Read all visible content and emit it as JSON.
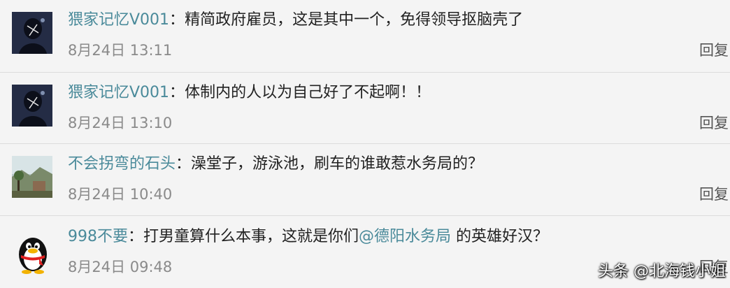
{
  "comments": [
    {
      "avatar": "dark-silhouette-avatar",
      "username": "猥家记忆V001",
      "colon": "：",
      "text": "精简政府雇员，这是其中一个，免得领导抠脑壳了",
      "time": "8月24日 13:11",
      "reply": "回复"
    },
    {
      "avatar": "dark-silhouette-avatar",
      "username": "猥家记忆V001",
      "colon": "：",
      "text": "体制内的人以为自己好了不起啊！！",
      "time": "8月24日 13:10",
      "reply": "回复"
    },
    {
      "avatar": "landscape-photo-avatar",
      "username": "不会拐弯的石头",
      "colon": "：",
      "text": "澡堂子，游泳池，刷车的谁敢惹水务局的？",
      "time": "8月24日 10:40",
      "reply": "回复"
    },
    {
      "avatar": "qq-penguin-avatar",
      "username": "998不要",
      "colon": "：",
      "text_before": "打男童算什么本事，这就是你们",
      "mention": "@德阳水务局",
      "text_after": " 的英雄好汉？",
      "time": "8月24日 09:48",
      "reply": "回复"
    }
  ],
  "watermark": "头条 @北海钱小姐",
  "colors": {
    "username": "#4a8a9a",
    "text": "#222222",
    "time": "#8a8a8a",
    "background": "#f4f4f4"
  }
}
